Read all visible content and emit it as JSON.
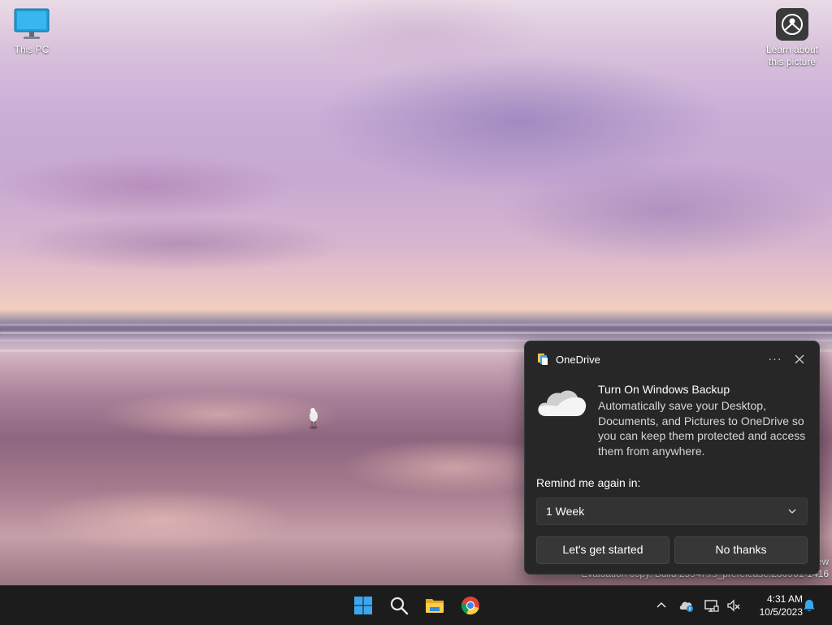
{
  "desktop": {
    "icons": [
      {
        "label": "This PC"
      },
      {
        "label": "Learn about\nthis picture"
      }
    ],
    "watermark": {
      "line1": "ew",
      "line2": "Evaluation copy. Build 25947.rs_prerelease.230901-1416"
    }
  },
  "toast": {
    "app_name": "OneDrive",
    "more_label": "···",
    "title": "Turn On Windows Backup",
    "body": "Automatically save your Desktop, Documents, and Pictures to OneDrive so you can keep them protected and access them from anywhere.",
    "remind_label": "Remind me again in:",
    "remind_value": "1 Week",
    "primary_button": "Let's get started",
    "secondary_button": "No thanks"
  },
  "taskbar": {
    "pinned": [
      {
        "icon": "windows-start-icon"
      },
      {
        "icon": "search-icon"
      },
      {
        "icon": "file-explorer-icon"
      },
      {
        "icon": "chrome-icon"
      }
    ],
    "tray": {
      "time": "4:31 AM",
      "date": "10/5/2023"
    }
  },
  "colors": {
    "toast_bg": "#272727",
    "taskbar_bg": "#1c1c1c",
    "accent": "#2fa8f0"
  }
}
